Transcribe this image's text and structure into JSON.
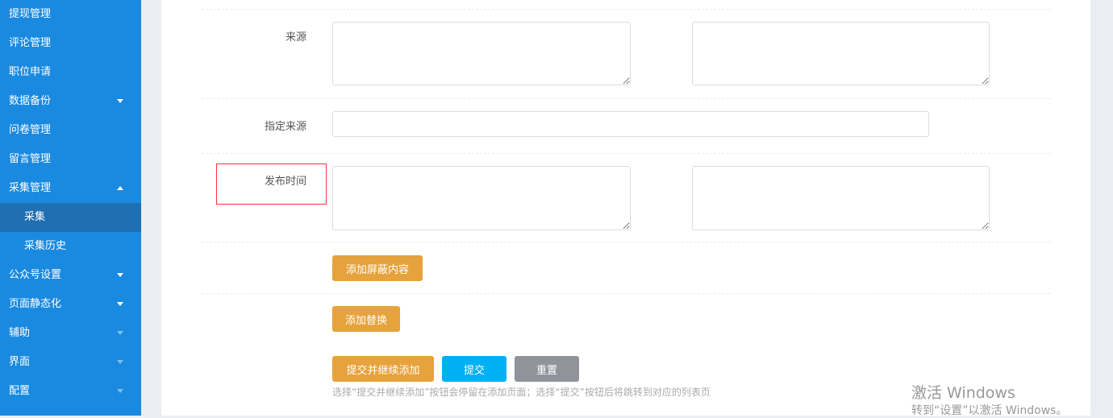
{
  "sidebar": {
    "items": [
      {
        "label": "提现管理"
      },
      {
        "label": "评论管理"
      },
      {
        "label": "职位申请"
      },
      {
        "label": "数据备份"
      },
      {
        "label": "问卷管理"
      },
      {
        "label": "留言管理"
      },
      {
        "label": "采集管理"
      },
      {
        "label": "采集"
      },
      {
        "label": "采集历史"
      },
      {
        "label": "公众号设置"
      },
      {
        "label": "页面静态化"
      },
      {
        "label": "辅助"
      },
      {
        "label": "界面"
      },
      {
        "label": "配置"
      }
    ]
  },
  "form": {
    "source_label": "来源",
    "specified_source_label": "指定来源",
    "publish_time_label": "发布时间",
    "add_block_button": "添加屏蔽内容",
    "add_replace_button": "添加替换",
    "submit_continue_button": "提交并继续添加",
    "submit_button": "提交",
    "reset_button": "重置",
    "hint": "选择“提交并继续添加”按钮会停留在添加页面；选择“提交”按钮后将跳转到对应的列表页"
  },
  "watermark": {
    "line1": "激活 Windows",
    "line2": "转到“设置”以激活 Windows。"
  }
}
